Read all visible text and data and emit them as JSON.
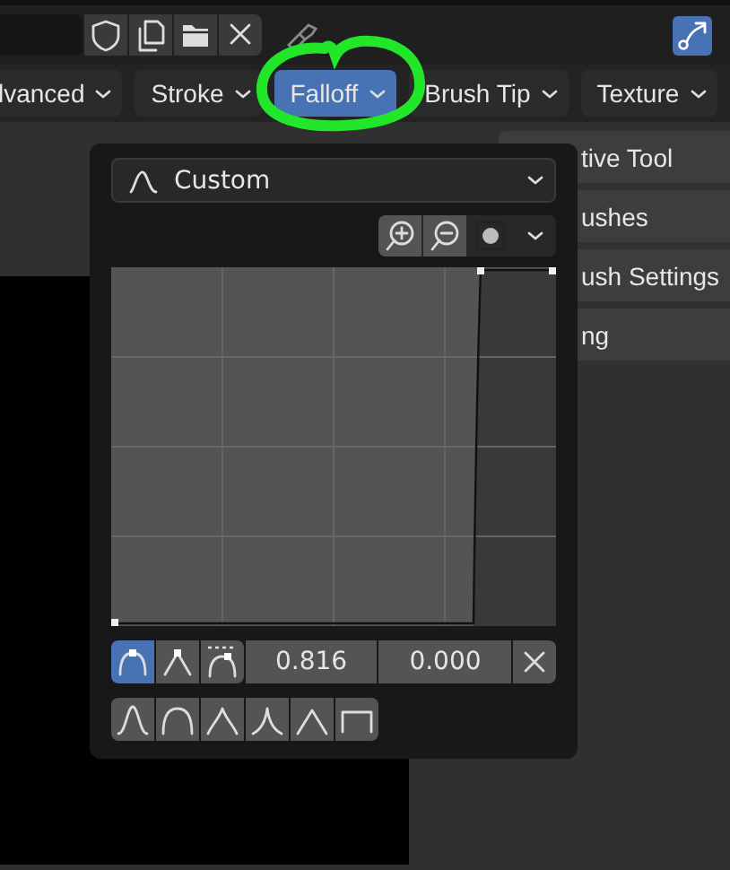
{
  "tabs": [
    {
      "label": "lvanced",
      "selected": false
    },
    {
      "label": "Stroke",
      "selected": false
    },
    {
      "label": "Falloff",
      "selected": true
    },
    {
      "label": "Brush Tip",
      "selected": false
    },
    {
      "label": "Texture",
      "selected": false
    }
  ],
  "sidebar": {
    "items": [
      "tive Tool",
      "ushes",
      "ush Settings",
      "ng"
    ]
  },
  "popup": {
    "preset": "Custom",
    "handle_types": [
      {
        "kind": "auto",
        "selected": true
      },
      {
        "kind": "vector",
        "selected": false
      },
      {
        "kind": "clamped",
        "selected": false
      }
    ],
    "x_value": "0.816",
    "y_value": "0.000",
    "shape_presets": [
      {
        "kind": "smooth"
      },
      {
        "kind": "round"
      },
      {
        "kind": "root"
      },
      {
        "kind": "sharp"
      },
      {
        "kind": "linear"
      },
      {
        "kind": "constant"
      }
    ]
  }
}
